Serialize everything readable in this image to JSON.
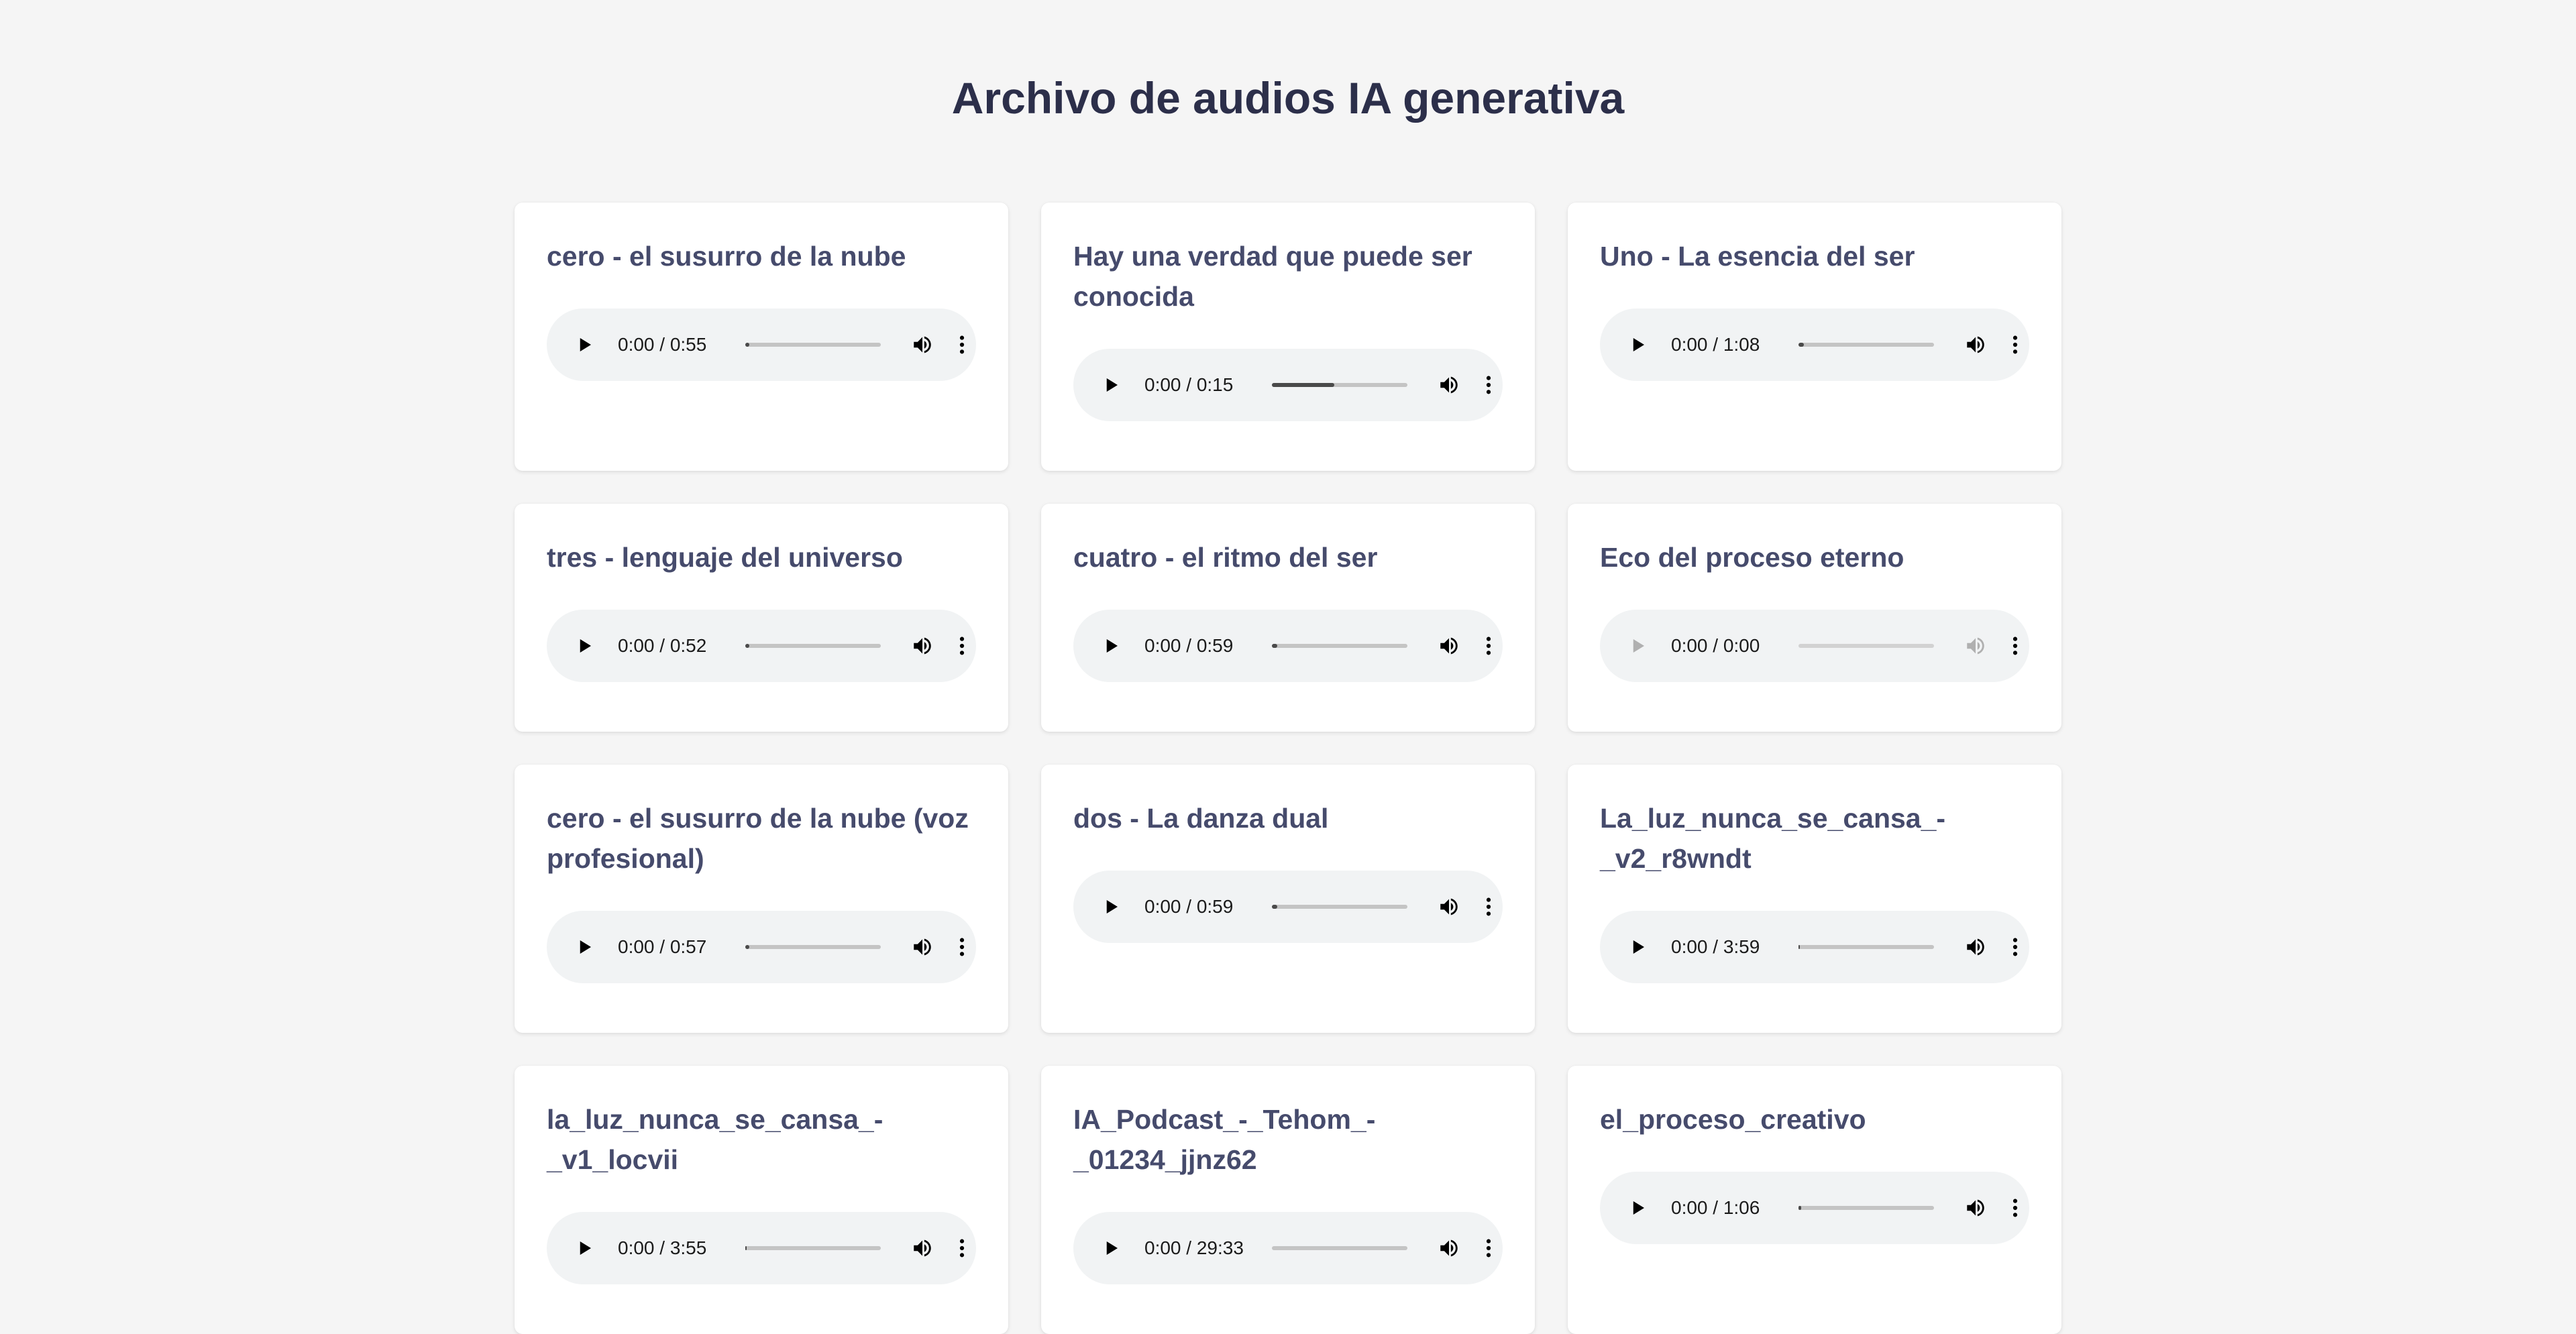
{
  "page": {
    "title": "Archivo de audios IA generativa"
  },
  "colors": {
    "background": "#f5f5f5",
    "card": "#ffffff",
    "title": "#2c2f4a",
    "card_title": "#464b6c",
    "player": "#f1f3f4"
  },
  "icons": {
    "play": "play-icon",
    "volume": "volume-icon",
    "more": "more-vertical-icon"
  },
  "audios": [
    {
      "title": "cero - el susurro de la nube",
      "time": "0:00 / 0:55",
      "progress": 0.03,
      "disabled": false
    },
    {
      "title": "Hay una verdad que puede ser conocida",
      "time": "0:00 / 0:15",
      "progress": 0.46,
      "disabled": false
    },
    {
      "title": "Uno - La esencia del ser",
      "time": "0:00 / 1:08",
      "progress": 0.04,
      "disabled": false
    },
    {
      "title": "tres - lenguaje del universo",
      "time": "0:00 / 0:52",
      "progress": 0.03,
      "disabled": false
    },
    {
      "title": "cuatro - el ritmo del ser",
      "time": "0:00 / 0:59",
      "progress": 0.04,
      "disabled": false
    },
    {
      "title": "Eco del proceso eterno",
      "time": "0:00 / 0:00",
      "progress": 0,
      "disabled": true
    },
    {
      "title": "cero - el susurro de la nube (voz profesional)",
      "time": "0:00 / 0:57",
      "progress": 0.03,
      "disabled": false
    },
    {
      "title": "dos - La danza dual",
      "time": "0:00 / 0:59",
      "progress": 0.04,
      "disabled": false
    },
    {
      "title": "La_luz_nunca_se_cansa_-_v2_r8wndt",
      "time": "0:00 / 3:59",
      "progress": 0.01,
      "disabled": false
    },
    {
      "title": "la_luz_nunca_se_cansa_-_v1_locvii",
      "time": "0:00 / 3:55",
      "progress": 0.01,
      "disabled": false
    },
    {
      "title": "IA_Podcast_-_Tehom_-_01234_jjnz62",
      "time": "0:00 / 29:33",
      "progress": 0.0,
      "disabled": false
    },
    {
      "title": "el_proceso_creativo",
      "time": "0:00 / 1:06",
      "progress": 0.02,
      "disabled": false
    }
  ]
}
